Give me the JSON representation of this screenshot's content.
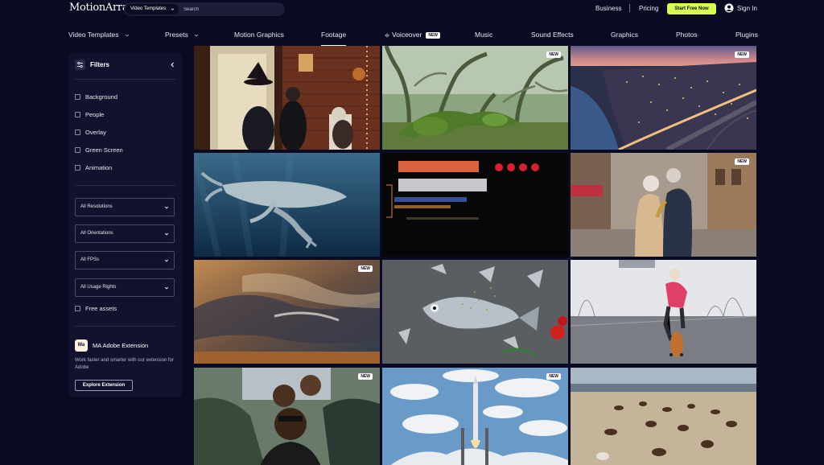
{
  "header": {
    "logo": "MotionArray",
    "search_type": "Video Templates",
    "search_placeholder": "Search",
    "links": [
      "Business",
      "Pricing"
    ],
    "cta": "Start Free Now",
    "signin": "Sign In"
  },
  "nav": {
    "items": [
      {
        "label": "Video Templates",
        "chevron": true
      },
      {
        "label": "Presets",
        "chevron": true
      },
      {
        "label": "Motion Graphics"
      },
      {
        "label": "Footage",
        "active": true
      },
      {
        "label": "Voiceover",
        "badge": "NEW"
      },
      {
        "label": "Music"
      },
      {
        "label": "Sound Effects"
      },
      {
        "label": "Graphics"
      },
      {
        "label": "Photos"
      },
      {
        "label": "Plugins"
      }
    ]
  },
  "sidebar": {
    "title": "Filters",
    "checkboxes": [
      "Background",
      "People",
      "Overlay",
      "Green Screen",
      "Animation"
    ],
    "selects": [
      "All Resolutions",
      "All Orientations",
      "All FPSs",
      "All Usage Rights"
    ],
    "free_assets": "Free assets",
    "extension": {
      "logo": "Ma",
      "title": "MA Adobe Extension",
      "desc": "Work faster and smarter with our extension for Adobe",
      "button": "Explore Extension"
    }
  },
  "tiles": [
    {
      "scene": "halloween",
      "new": ""
    },
    {
      "scene": "forest",
      "new": "NEW"
    },
    {
      "scene": "city",
      "new": "NEW"
    },
    {
      "scene": "whale",
      "new": ""
    },
    {
      "scene": "lights",
      "new": ""
    },
    {
      "scene": "couple",
      "new": "NEW"
    },
    {
      "scene": "storm",
      "new": "NEW"
    },
    {
      "scene": "fish",
      "new": ""
    },
    {
      "scene": "skater",
      "new": ""
    },
    {
      "scene": "friends",
      "new": "NEW"
    },
    {
      "scene": "rocket",
      "new": "NEW"
    },
    {
      "scene": "horses",
      "new": ""
    }
  ],
  "colors": {
    "accent": "#d7fd4f",
    "background": "#0a0a23",
    "panel": "#12122e"
  }
}
